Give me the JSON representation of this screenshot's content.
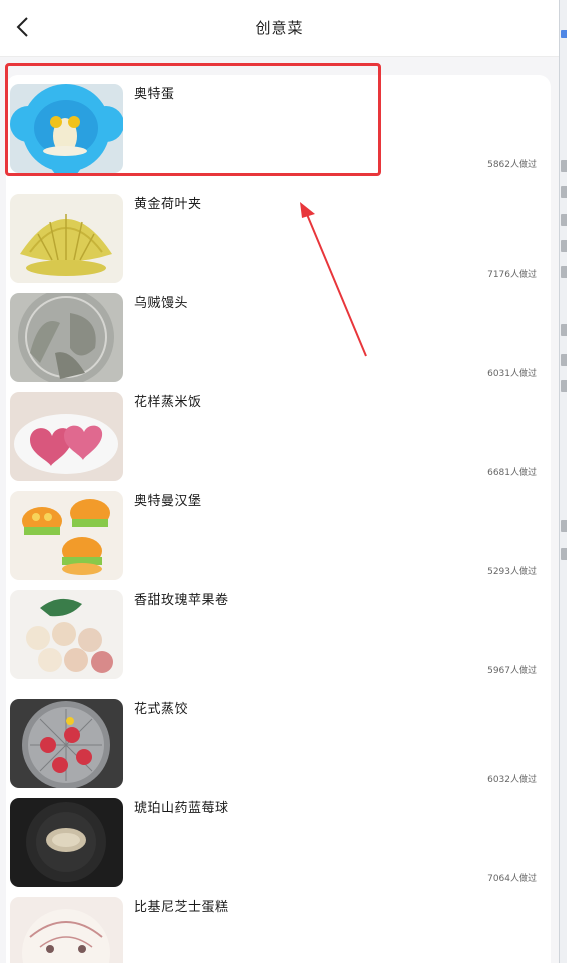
{
  "header": {
    "title": "创意菜",
    "back_icon": "chevron-left-icon"
  },
  "recipes": [
    {
      "name": "奥特蛋",
      "count": "5862人做过"
    },
    {
      "name": "黄金荷叶夹",
      "count": "7176人做过"
    },
    {
      "name": "乌贼馒头",
      "count": "6031人做过"
    },
    {
      "name": "花样蒸米饭",
      "count": "6681人做过"
    },
    {
      "name": "奥特曼汉堡",
      "count": "5293人做过"
    },
    {
      "name": "香甜玫瑰苹果卷",
      "count": "5967人做过"
    },
    {
      "name": "花式蒸饺",
      "count": "6032人做过"
    },
    {
      "name": "琥珀山药蓝莓球",
      "count": "7064人做过"
    },
    {
      "name": "比基尼芝士蛋糕",
      "count": ""
    }
  ],
  "annotation": {
    "highlight_color": "#e8363b",
    "highlighted_item": "奥特蛋"
  }
}
